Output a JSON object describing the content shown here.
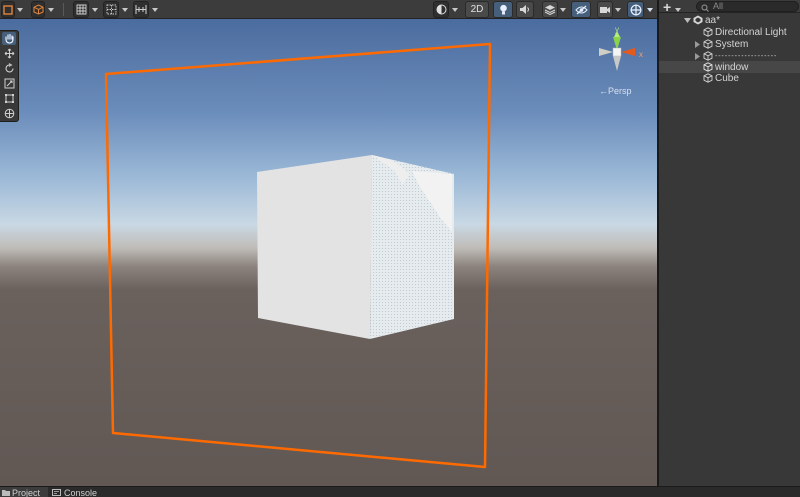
{
  "toolbar": {
    "toggle_2d": "2D"
  },
  "tools": [
    {
      "name": "hand-tool",
      "selected": true
    },
    {
      "name": "move-tool",
      "selected": false
    },
    {
      "name": "rotate-tool",
      "selected": false
    },
    {
      "name": "scale-tool",
      "selected": false
    },
    {
      "name": "rect-tool",
      "selected": false
    },
    {
      "name": "transform-tool",
      "selected": false
    }
  ],
  "gizmo": {
    "projection_label": "←Persp",
    "axes": {
      "y": "y",
      "x": "x"
    }
  },
  "hierarchy": {
    "search_placeholder": "All",
    "scene_name": "aa*",
    "items": [
      {
        "label": "Directional Light",
        "expandable": false
      },
      {
        "label": "System",
        "expandable": true
      },
      {
        "label": "- - - - - - - - - - - - - - - - - - -",
        "expandable": true
      },
      {
        "label": "window",
        "expandable": false
      },
      {
        "label": "Cube",
        "expandable": false
      }
    ]
  },
  "bottom_tabs": {
    "project": "Project",
    "console": "Console"
  },
  "colors": {
    "selection_outline": "#ff6a00",
    "gizmo_x": "#e45a1e",
    "gizmo_y": "#8ad34a",
    "toolbar_bg": "#3c3c3c",
    "panel_bg": "#383838",
    "selected_button": "#46607c"
  }
}
